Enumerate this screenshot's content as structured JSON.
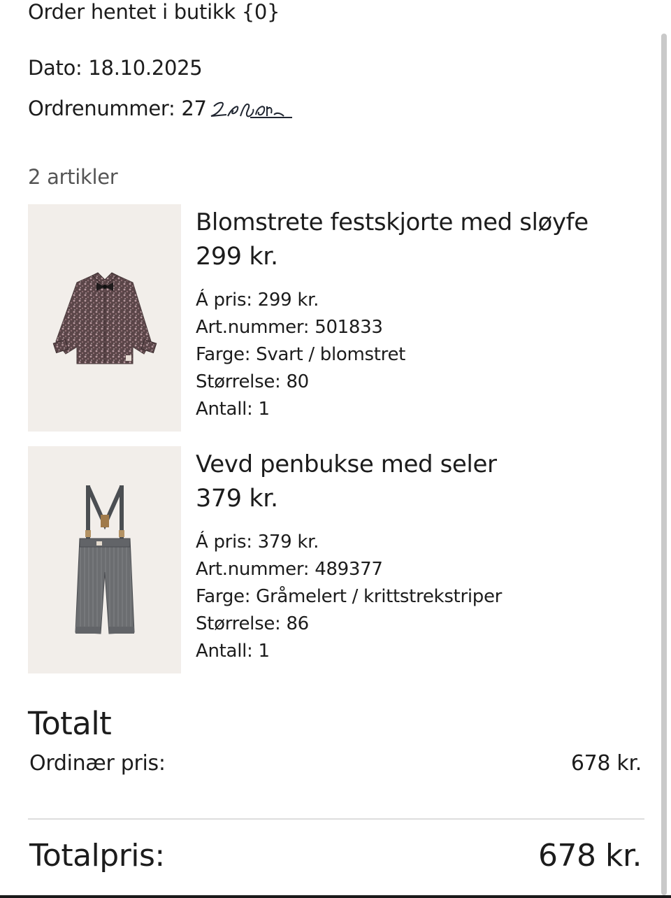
{
  "header": {
    "title": "Order hentet i butikk {0}",
    "date": "Dato: 18.10.2025",
    "order_number_prefix": "Ordrenummer: 27",
    "order_number_scribble": "2601"
  },
  "summary": {
    "article_count": "2 artikler"
  },
  "products": [
    {
      "name": "Blomstrete festskjorte med sløyfe",
      "price": "299 kr.",
      "unit_price": "Á pris: 299 kr.",
      "article_number": "Art.nummer: 501833",
      "color": "Farge: Svart / blomstret",
      "size": "Størrelse: 80",
      "quantity": "Antall: 1",
      "image_icon": "floral-shirt-icon"
    },
    {
      "name": "Vevd penbukse med seler",
      "price": "379 kr.",
      "unit_price": "Á pris: 379 kr.",
      "article_number": "Art.nummer: 489377",
      "color": "Farge: Gråmelert / krittstrekstriper",
      "size": "Størrelse: 86",
      "quantity": "Antall: 1",
      "image_icon": "trousers-with-suspenders-icon"
    }
  ],
  "totals": {
    "title": "Totalt",
    "ordinary_label": "Ordinær pris:",
    "ordinary_value": "678 kr.",
    "total_label": "Totalpris:",
    "total_value": "678 kr."
  },
  "colors": {
    "text": "#1c1c1c",
    "muted": "#555555",
    "image_background": "#f2eeea",
    "divider": "#dddddd"
  }
}
